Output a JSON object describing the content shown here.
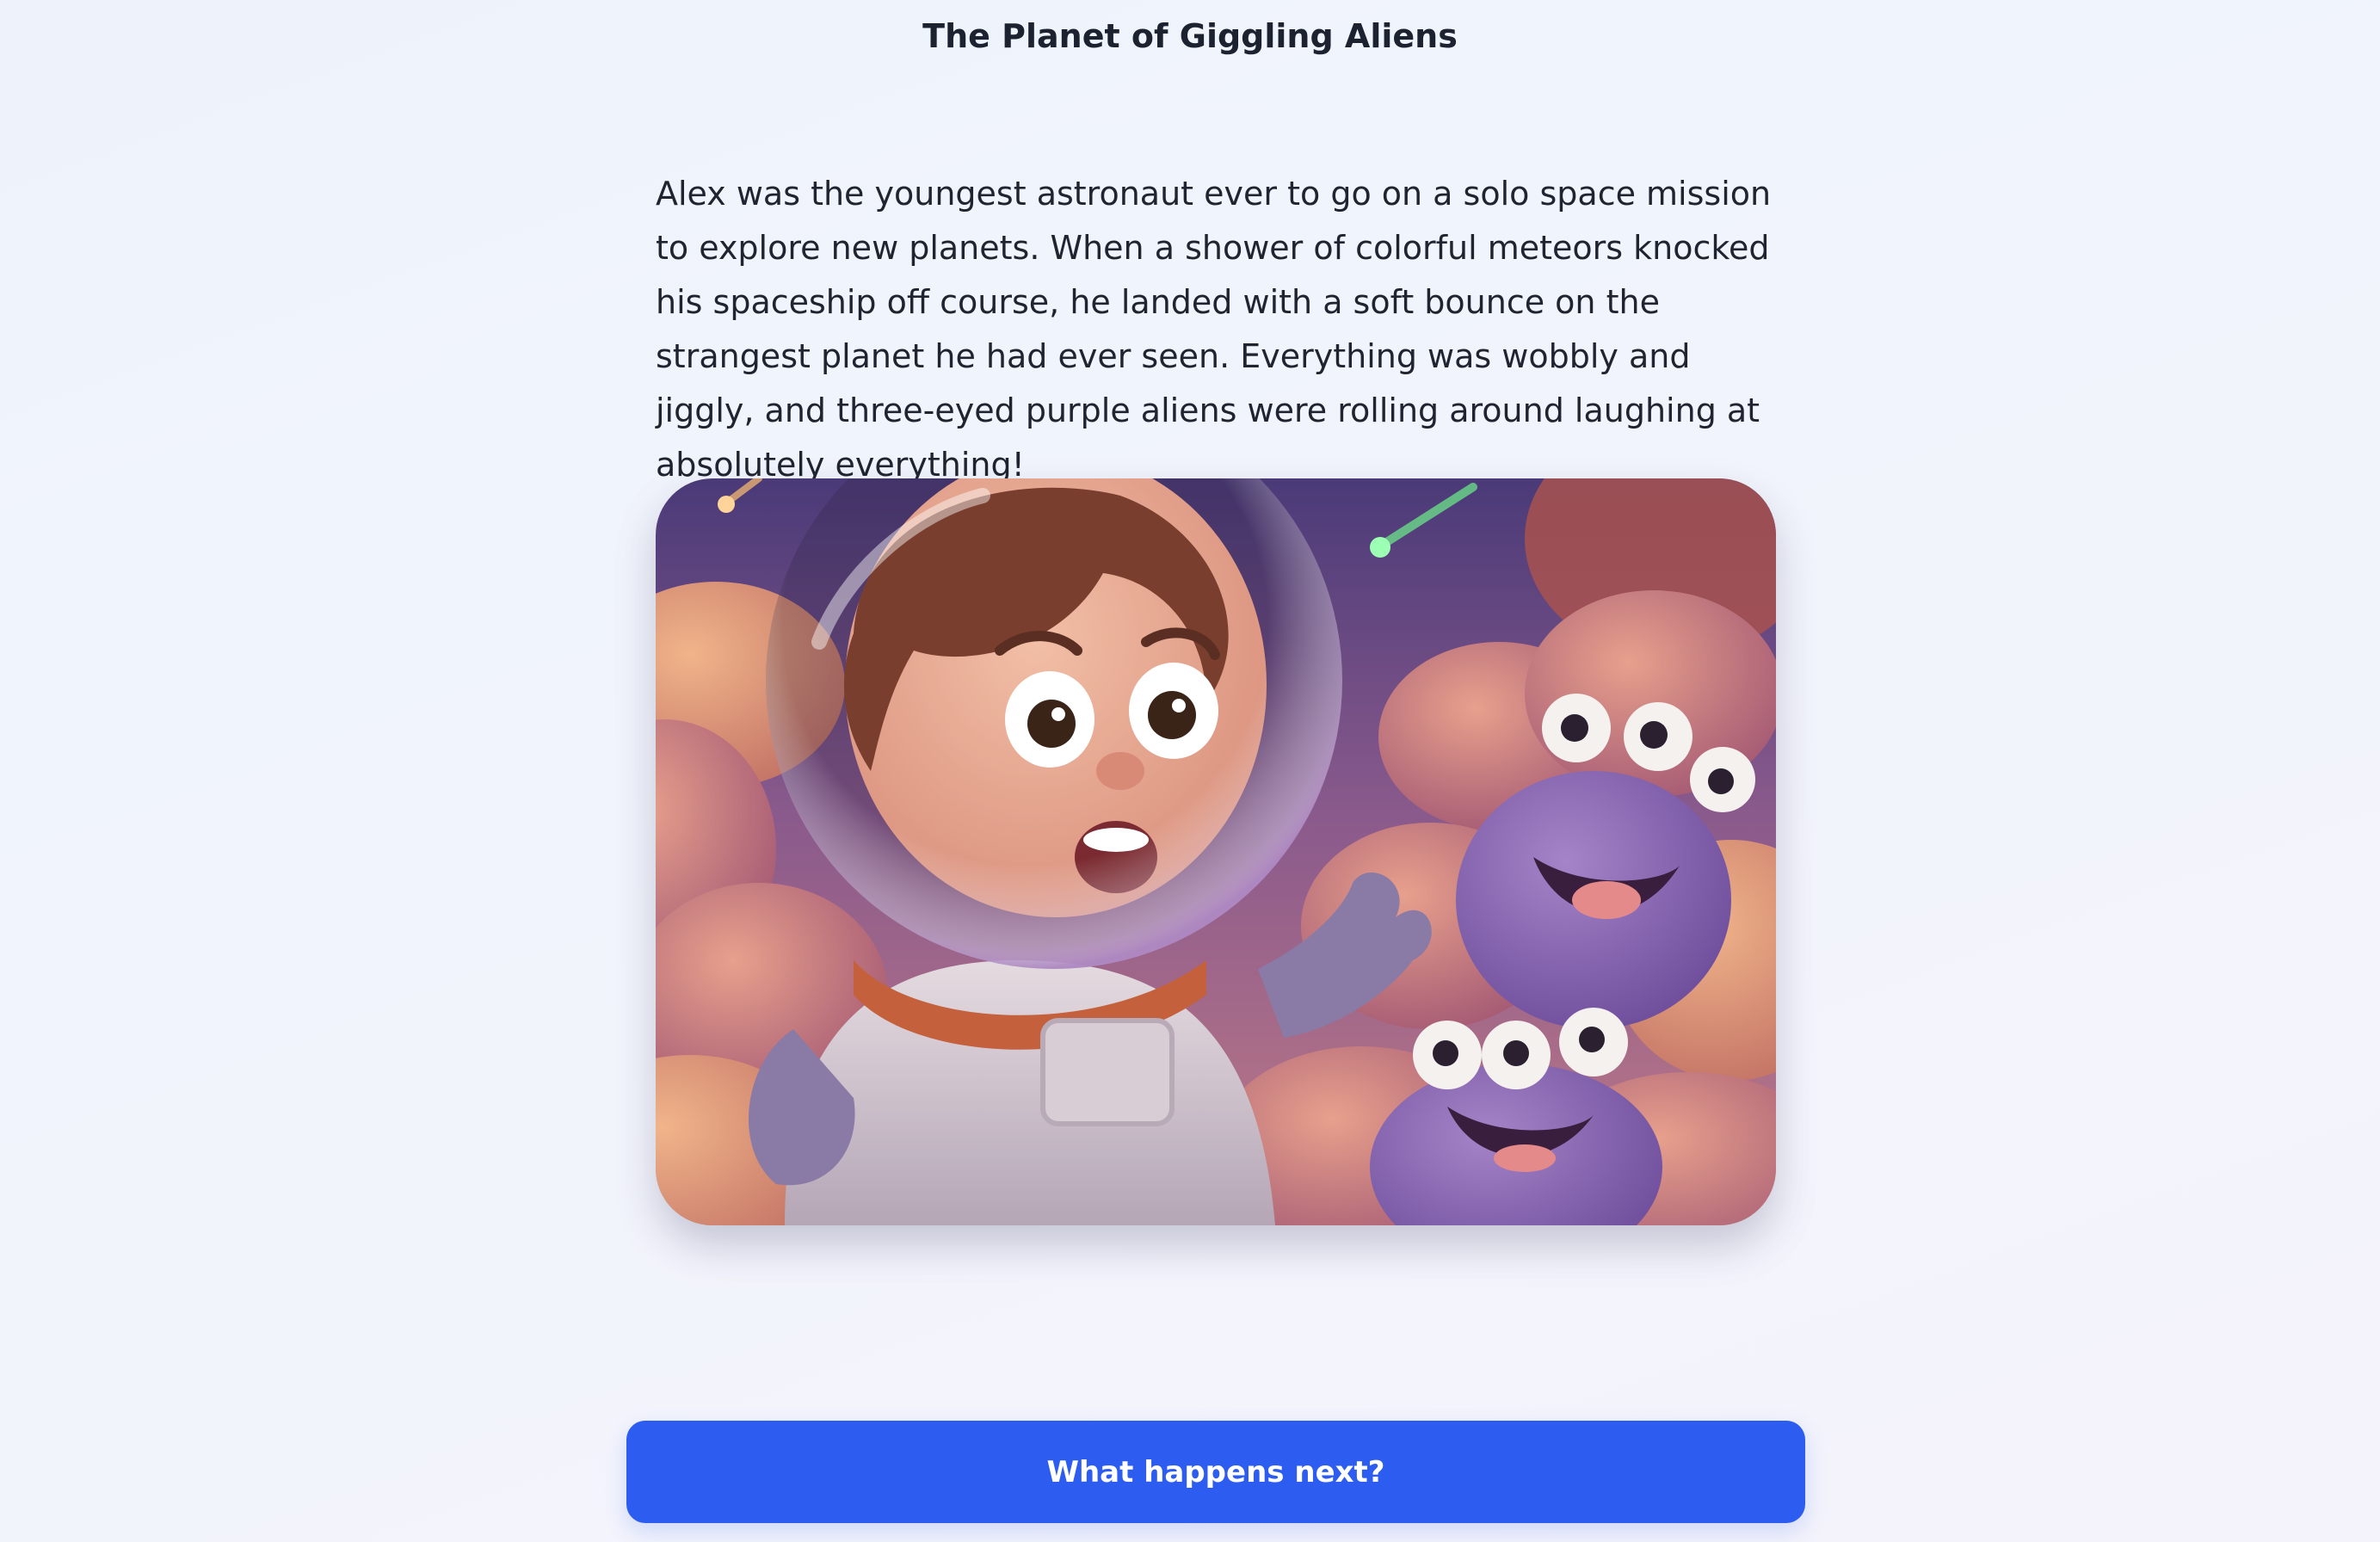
{
  "story": {
    "title": "The Planet of Giggling Aliens",
    "paragraph": "Alex was the youngest astronaut ever to go on a solo space mission to explore new planets. When a shower of colorful meteors knocked his spaceship off course, he landed with a soft bounce on the strangest planet he had ever seen. Everything was wobbly and jiggly, and three-eyed purple aliens were rolling around laughing at absolutely everything!",
    "illustration": "astronaut-boy-with-purple-aliens"
  },
  "actions": {
    "next_label": "What happens next?"
  },
  "colors": {
    "accent": "#2c5cf0",
    "title": "#1c2230",
    "text": "#1f2430",
    "background": "#f0f3fb"
  }
}
